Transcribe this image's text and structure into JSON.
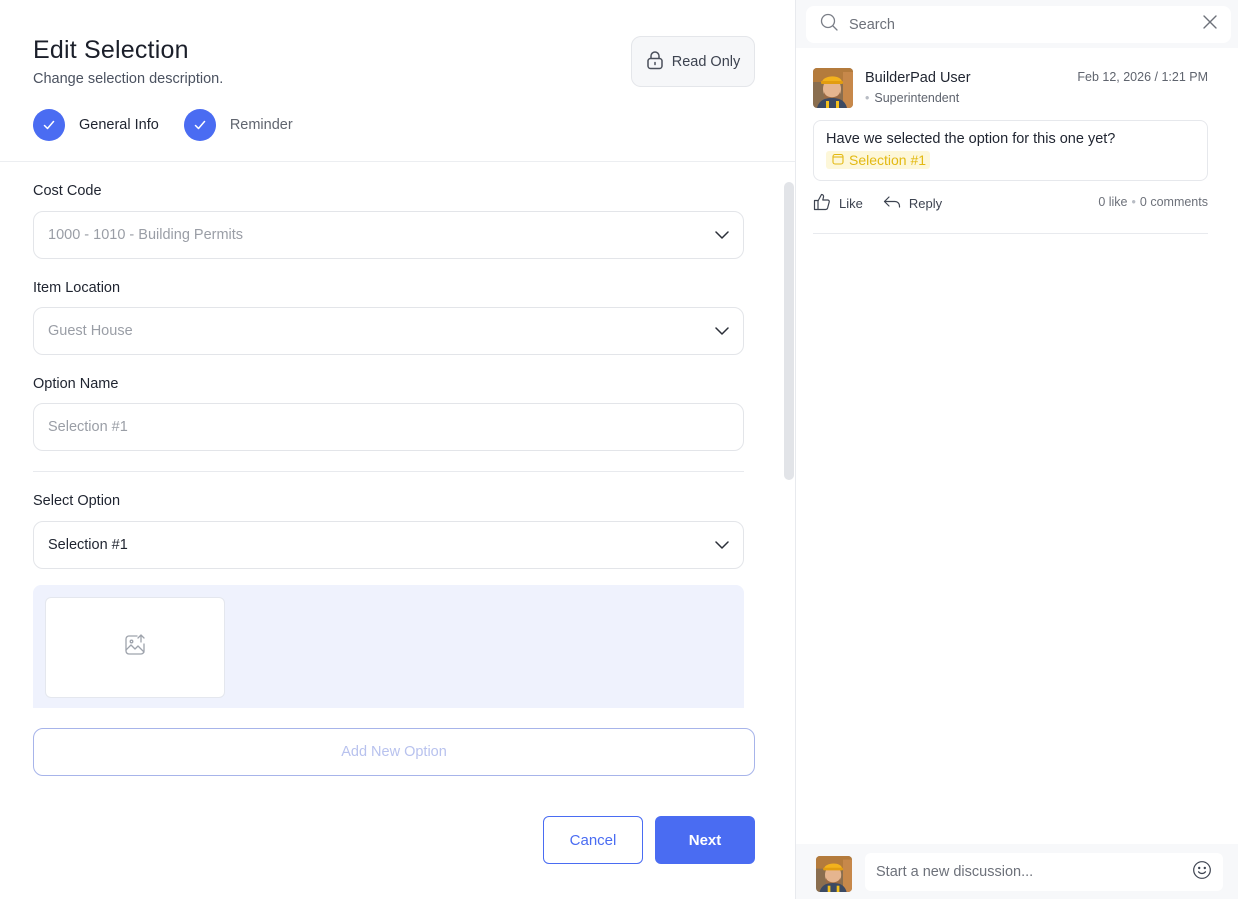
{
  "form": {
    "title": "Edit Selection",
    "subtitle": "Change selection description.",
    "read_only_label": "Read Only",
    "steps": [
      {
        "label": "General Info",
        "completed": true
      },
      {
        "label": "Reminder",
        "completed": true
      }
    ],
    "cost_code": {
      "label": "Cost Code",
      "value": "1000 - 1010 - Building Permits"
    },
    "item_location": {
      "label": "Item Location",
      "value": "Guest House"
    },
    "option_name": {
      "label": "Option Name",
      "value": "Selection #1"
    },
    "select_option": {
      "label": "Select Option",
      "value": "Selection #1"
    },
    "add_new_option_label": "Add New Option",
    "cancel_label": "Cancel",
    "next_label": "Next"
  },
  "discussion": {
    "search_placeholder": "Search",
    "post": {
      "author": "BuilderPad User",
      "role": "Superintendent",
      "timestamp": "Feb 12, 2026 / 1:21 PM",
      "message": "Have we selected the option for this one yet?",
      "tag": "Selection #1",
      "like_label": "Like",
      "reply_label": "Reply",
      "likes": "0 like",
      "comments": "0 comments"
    },
    "composer_placeholder": "Start a new discussion..."
  },
  "colors": {
    "primary": "#4a6cf2",
    "tag_bg": "#fdf7d9",
    "tag_text": "#e3b912",
    "upload_bg": "#eff2fd"
  }
}
